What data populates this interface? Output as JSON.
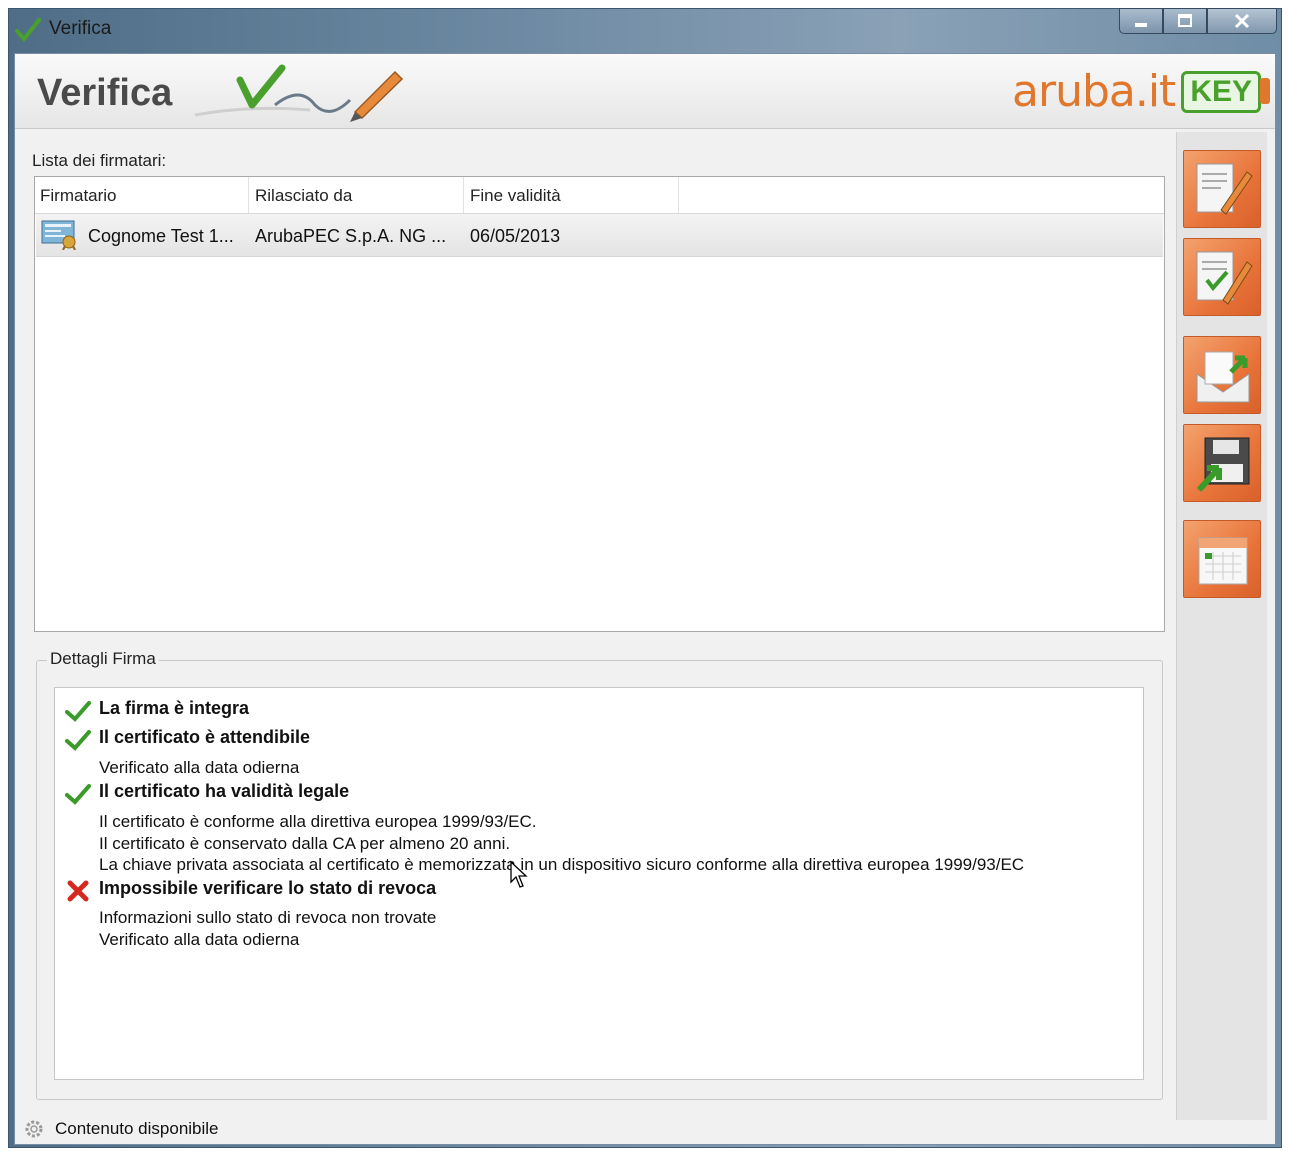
{
  "window": {
    "title": "Verifica",
    "buttons": [
      "minimize",
      "maximize",
      "close"
    ]
  },
  "header": {
    "title": "Verifica",
    "brand_text": "aruba.it",
    "brand_key": "KEY"
  },
  "signers": {
    "section_label": "Lista dei firmatari:",
    "columns": [
      "Firmatario",
      "Rilasciato da",
      "Fine validità"
    ],
    "rows": [
      {
        "firmatario": "Cognome Test 1...",
        "rilasciato_da": "ArubaPEC S.p.A. NG ...",
        "fine_validita": "06/05/2013",
        "icon": "certificate-icon"
      }
    ]
  },
  "sidebar": {
    "buttons": [
      "sign-document-icon",
      "verify-signature-icon",
      "email-send-icon",
      "save-export-icon",
      "calendar-timestamp-icon"
    ]
  },
  "details": {
    "legend": "Dettagli Firma",
    "items": [
      {
        "status": "ok",
        "title": "La firma è integra",
        "lines": []
      },
      {
        "status": "ok",
        "title": "Il certificato è attendibile",
        "lines": [
          "Verificato alla data odierna"
        ]
      },
      {
        "status": "ok",
        "title": "Il certificato ha validità legale",
        "lines": [
          "Il certificato è conforme alla direttiva europea 1999/93/EC.",
          "Il certificato è conservato dalla CA per almeno 20 anni.",
          "La chiave privata associata al certificato è memorizzata in un dispositivo sicuro conforme alla direttiva europea 1999/93/EC"
        ]
      },
      {
        "status": "error",
        "title": "Impossibile verificare lo stato di revoca",
        "lines": [
          "Informazioni sullo stato di revoca non trovate",
          "Verificato alla data odierna"
        ]
      }
    ]
  },
  "statusbar": {
    "text": "Contenuto disponibile"
  },
  "colors": {
    "accent_orange": "#e8743a",
    "ok_green": "#3a9a2a",
    "error_red": "#d42a1e",
    "brand_green": "#4aa02c"
  }
}
